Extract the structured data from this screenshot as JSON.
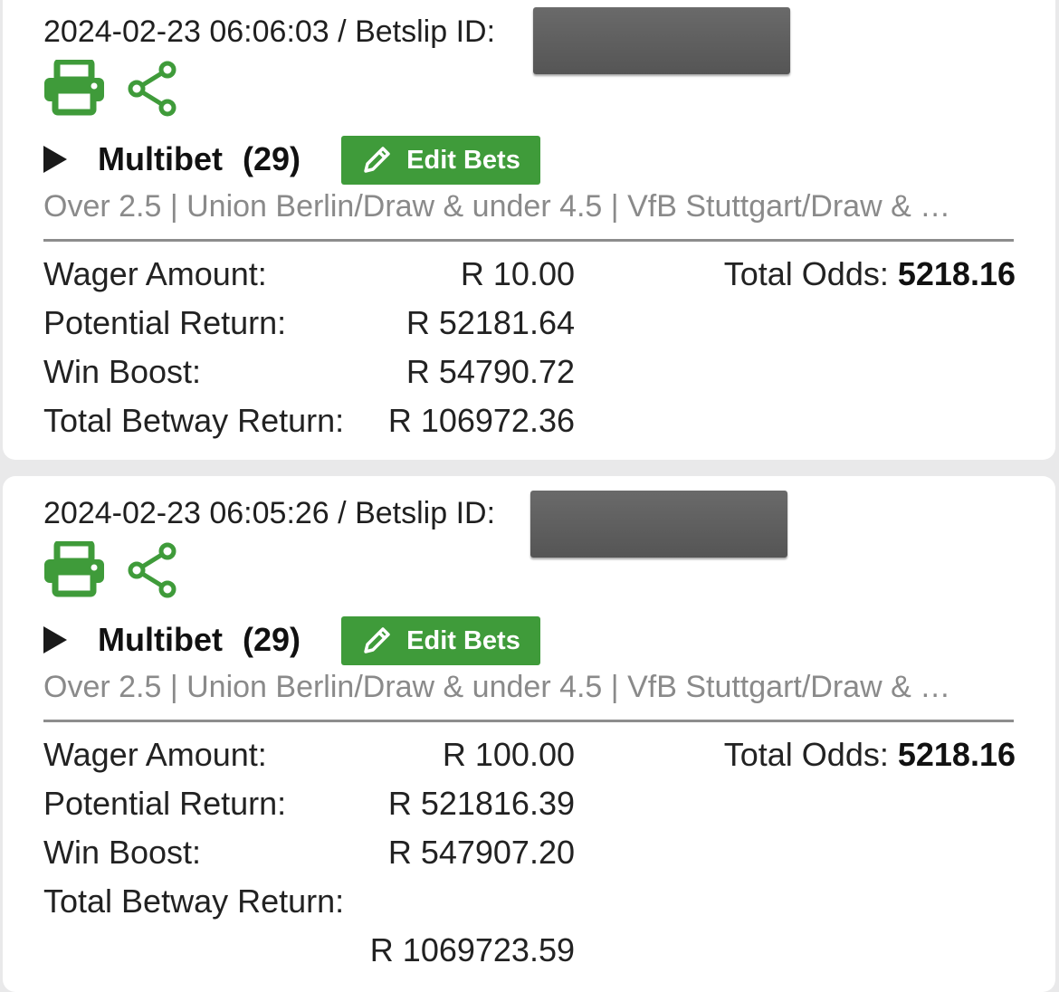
{
  "bets": [
    {
      "datetime": "2024-02-23 06:06:03",
      "betslip_label": "Betslip ID:",
      "separator": "/",
      "bet_type": "Multibet",
      "selection_count": "(29)",
      "edit_label": "Edit Bets",
      "summary": "Over 2.5 | Union Berlin/Draw & under 4.5 | VfB Stuttgart/Draw & …",
      "wager_label": "Wager Amount:",
      "wager_value": "R 10.00",
      "potential_label": "Potential Return:",
      "potential_value": "R 52181.64",
      "boost_label": "Win Boost:",
      "boost_value": "R 54790.72",
      "total_label": "Total Betway Return:",
      "total_value": "R 106972.36",
      "odds_label": "Total Odds:",
      "odds_value": "5218.16"
    },
    {
      "datetime": "2024-02-23 06:05:26",
      "betslip_label": "Betslip ID:",
      "separator": "/",
      "bet_type": "Multibet",
      "selection_count": "(29)",
      "edit_label": "Edit Bets",
      "summary": "Over 2.5 | Union Berlin/Draw & under 4.5 | VfB Stuttgart/Draw & …",
      "wager_label": "Wager Amount:",
      "wager_value": "R 100.00",
      "potential_label": "Potential Return:",
      "potential_value": "R 521816.39",
      "boost_label": "Win Boost:",
      "boost_value": "R 547907.20",
      "total_label": "Total Betway Return:",
      "total_value": "R 1069723.59",
      "odds_label": "Total Odds:",
      "odds_value": "5218.16"
    }
  ],
  "icons": [
    "print-icon",
    "share-icon",
    "play-icon",
    "pencil-icon"
  ],
  "colors": {
    "accent_green": "#3f9b3a",
    "summary_gray": "#8a8a8a",
    "background": "#e9e9ea"
  }
}
